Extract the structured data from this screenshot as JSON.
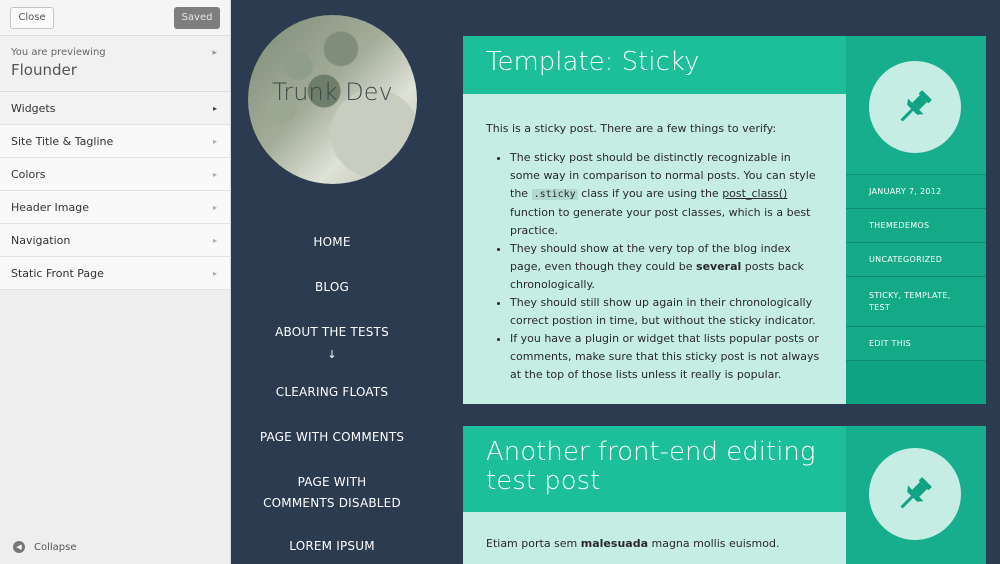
{
  "customizer": {
    "close_label": "Close",
    "saved_label": "Saved",
    "previewing_label": "You are previewing",
    "theme_name": "Flounder",
    "sections": [
      "Widgets",
      "Site Title & Tagline",
      "Colors",
      "Header Image",
      "Navigation",
      "Static Front Page"
    ],
    "collapse_label": "Collapse"
  },
  "site": {
    "logo_text": "Trunk Dev",
    "nav": {
      "items": [
        "HOME",
        "BLOG",
        "ABOUT THE TESTS"
      ],
      "arrow": "↓",
      "more": [
        "CLEARING FLOATS",
        "PAGE WITH COMMENTS",
        "PAGE WITH COMMENTS DISABLED",
        "LOREM IPSUM"
      ]
    }
  },
  "posts": [
    {
      "title": "Template: Sticky",
      "intro": "This is a sticky post. There are a few things to verify:",
      "bullets": {
        "b1_a": "The sticky post should be distinctly recognizable in some way in comparison to normal posts. You can style the ",
        "b1_code": ".sticky",
        "b1_b": " class if you are using the ",
        "b1_link": "post_class()",
        "b1_c": " function to generate your post classes, which is a best practice.",
        "b2_a": "They should show at the very top of the blog index page, even though they could be ",
        "b2_bold": "several",
        "b2_b": " posts back chronologically.",
        "b3": "They should still show up again in their chronologically correct postion in time, but without the sticky indicator.",
        "b4": "If you have a plugin or widget that lists popular posts or comments, make sure that this sticky post is not always at the top of those lists unless it really is popular."
      },
      "meta": {
        "date": "JANUARY 7, 2012",
        "author": "THEMEDEMOS",
        "category": "UNCATEGORIZED",
        "tags": "STICKY, TEMPLATE, TEST",
        "edit": "EDIT THIS"
      }
    },
    {
      "title": "Another front-end editing test post",
      "body_a": "Etiam porta sem ",
      "body_bold": "malesuada",
      "body_b": " magna mollis euismod."
    }
  ],
  "colors": {
    "sidebar_bg": "#eeeeee",
    "site_bg": "#2c3b4f",
    "accent": "#1dbf9b",
    "accent_dark": "#0fa283",
    "post_bg": "#c5ede3"
  },
  "icons": [
    "chevron-right-icon",
    "pushpin-icon",
    "collapse-arrow-icon",
    "arrow-down-icon"
  ]
}
